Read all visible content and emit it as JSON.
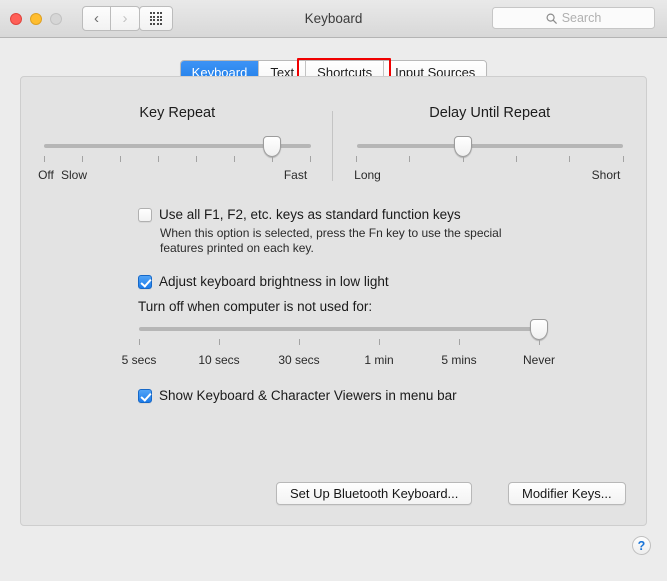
{
  "window": {
    "title": "Keyboard",
    "back_icon": "chevron-left-icon",
    "forward_icon": "chevron-right-icon",
    "grid_icon": "grid-apps-icon"
  },
  "search": {
    "placeholder": "Search",
    "value": "",
    "icon": "search-icon"
  },
  "tabs": [
    {
      "label": "Keyboard",
      "active": true
    },
    {
      "label": "Text",
      "active": false
    },
    {
      "label": "Shortcuts",
      "active": false,
      "highlighted": true
    },
    {
      "label": "Input Sources",
      "active": false
    }
  ],
  "highlight_color": "#f00000",
  "accent_color": "#1f7de8",
  "key_repeat": {
    "title": "Key Repeat",
    "ticks": 8,
    "thumb_index": 6,
    "labels": [
      {
        "text": "Off",
        "pos": 0
      },
      {
        "text": "Slow",
        "pos": 1
      },
      {
        "text": "Fast",
        "pos": 7
      }
    ]
  },
  "delay_until_repeat": {
    "title": "Delay Until Repeat",
    "ticks": 6,
    "thumb_index": 2,
    "labels": [
      {
        "text": "Long",
        "pos": 0
      },
      {
        "text": "Short",
        "pos": 5
      }
    ]
  },
  "function_keys": {
    "label": "Use all F1, F2, etc. keys as standard function keys",
    "checked": false,
    "help": "When this option is selected, press the Fn key to use the special features printed on each key."
  },
  "brightness": {
    "label": "Adjust keyboard brightness in low light",
    "checked": true
  },
  "turn_off": {
    "label": "Turn off when computer is not used for:",
    "ticks": 6,
    "thumb_index": 5,
    "labels": [
      "5 secs",
      "10 secs",
      "30 secs",
      "1 min",
      "5 mins",
      "Never"
    ]
  },
  "show_viewers": {
    "label": "Show Keyboard & Character Viewers in menu bar",
    "checked": true
  },
  "buttons": {
    "bluetooth": "Set Up Bluetooth Keyboard...",
    "modifier": "Modifier Keys..."
  },
  "help_button": {
    "label": "?"
  }
}
